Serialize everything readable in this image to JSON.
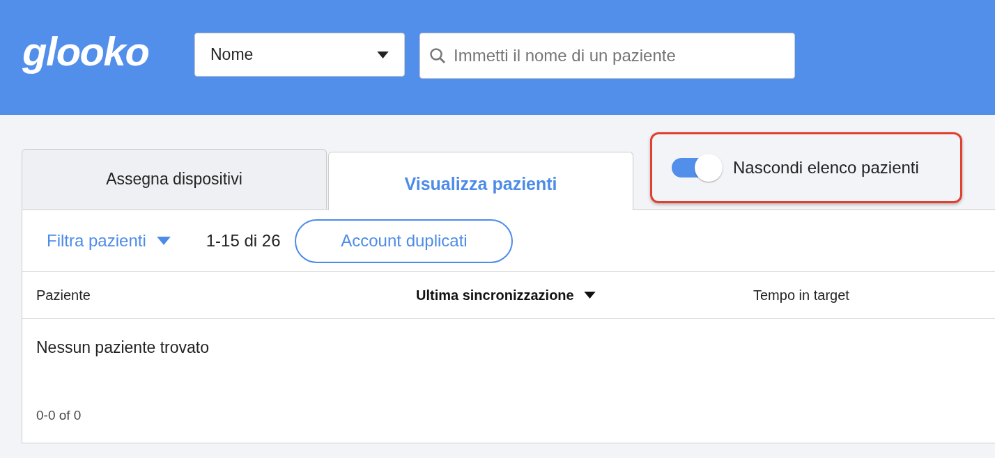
{
  "header": {
    "logo": "glooko",
    "search_type": {
      "value": "Nome"
    },
    "search": {
      "placeholder": "Immetti il nome di un paziente"
    }
  },
  "tabs": [
    {
      "label": "Assegna dispositivi",
      "selected": false
    },
    {
      "label": "Visualizza pazienti",
      "selected": true
    }
  ],
  "toggle": {
    "label": "Nascondi elenco pazienti",
    "on": true,
    "highlighted": true
  },
  "toolbar": {
    "filter": "Filtra pazienti",
    "range": "1-15 di 26",
    "button": "Account duplicati"
  },
  "table": {
    "columns": [
      {
        "label": "Paziente",
        "sorted": false
      },
      {
        "label": "Ultima sincronizzazione",
        "sorted": true
      },
      {
        "label": "Tempo in target",
        "sorted": false
      }
    ],
    "empty": "Nessun paziente trovato",
    "pagination": "0-0 of 0"
  }
}
